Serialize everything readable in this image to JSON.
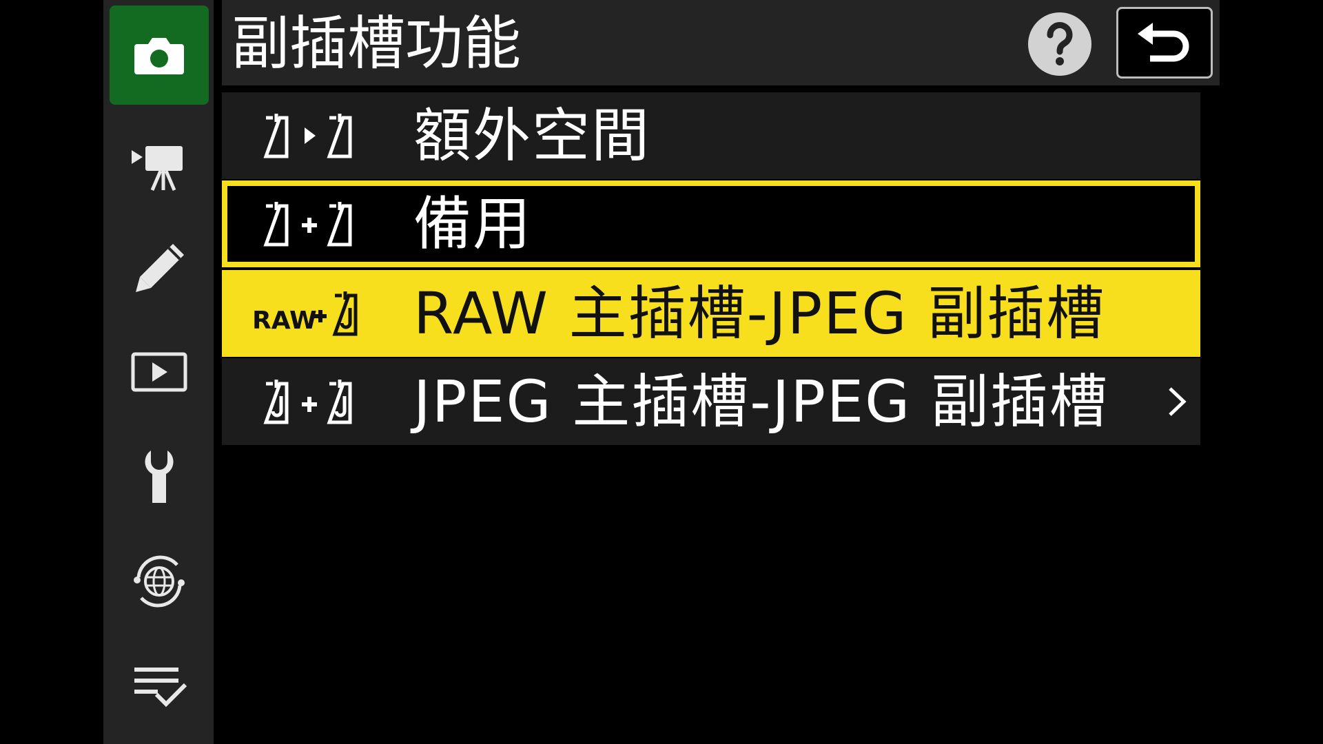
{
  "header": {
    "title": "副插槽功能",
    "help_icon": "help-icon",
    "back_icon": "return-icon"
  },
  "sidebar": {
    "items": [
      {
        "icon": "photo-shooting-camera-icon",
        "active": true
      },
      {
        "icon": "movie-camera-icon",
        "active": false
      },
      {
        "icon": "pencil-icon",
        "active": false
      },
      {
        "icon": "playback-icon",
        "active": false
      },
      {
        "icon": "wrench-icon",
        "active": false
      },
      {
        "icon": "network-globe-icon",
        "active": false
      },
      {
        "icon": "my-menu-checklist-icon",
        "active": false
      }
    ]
  },
  "menu": {
    "items": [
      {
        "label": "額外空間",
        "icon_text": "",
        "state": "normal"
      },
      {
        "label": "備用",
        "icon_text": "",
        "state": "outlined"
      },
      {
        "label": "RAW 主插槽-JPEG 副插槽",
        "icon_text": "RAW",
        "state": "highlighted"
      },
      {
        "label": "JPEG 主插槽-JPEG 副插槽",
        "icon_text": "",
        "state": "normal",
        "has_submenu": true
      }
    ]
  },
  "colors": {
    "accent_yellow": "#f7df1d",
    "active_green": "#136b22",
    "panel_gray": "#242424"
  }
}
